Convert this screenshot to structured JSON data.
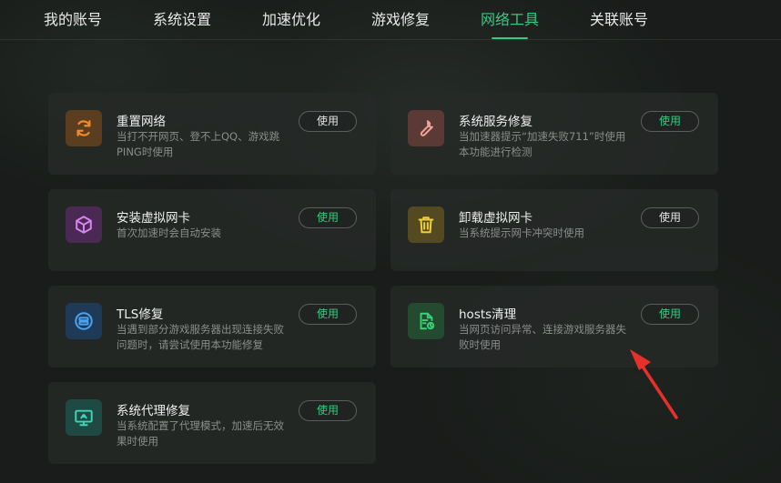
{
  "nav": {
    "tabs": [
      {
        "label": "我的账号"
      },
      {
        "label": "系统设置"
      },
      {
        "label": "加速优化"
      },
      {
        "label": "游戏修复"
      },
      {
        "label": "网络工具"
      },
      {
        "label": "关联账号"
      }
    ],
    "active_tab": "网络工具"
  },
  "tools": [
    {
      "title": "重置网络",
      "desc": "当打不开网页、登不上QQ、游戏跳PING时使用",
      "button": "使用",
      "icon": "refresh-icon",
      "tile_color": "#5a3e1f",
      "icon_color": "#f08a2a"
    },
    {
      "title": "系统服务修复",
      "desc": "当加速器提示“加速失败711”时使用本功能进行检测",
      "button": "使用",
      "icon": "wrench-icon",
      "tile_color": "#5b3a36",
      "icon_color": "#f0a39a"
    },
    {
      "title": "安装虚拟网卡",
      "desc": "首次加速时会自动安装",
      "button": "使用",
      "icon": "cube-icon",
      "tile_color": "#4a2a55",
      "icon_color": "#d784f0"
    },
    {
      "title": "卸载虚拟网卡",
      "desc": "当系统提示网卡冲突时使用",
      "button": "使用",
      "icon": "trash-icon",
      "tile_color": "#544a22",
      "icon_color": "#f0cf33"
    },
    {
      "title": "TLS修复",
      "desc": "当遇到部分游戏服务器出现连接失败问题时，请尝试使用本功能修复",
      "button": "使用",
      "icon": "server-icon",
      "tile_color": "#1e3a56",
      "icon_color": "#4aa3f0"
    },
    {
      "title": "hosts清理",
      "desc": "当网页访问异常、连接游戏服务器失败时使用",
      "button": "使用",
      "icon": "file-clean-icon",
      "tile_color": "#244a30",
      "icon_color": "#3ad278"
    },
    {
      "title": "系统代理修复",
      "desc": "当系统配置了代理模式，加速后无效果时使用",
      "button": "使用",
      "icon": "monitor-icon",
      "tile_color": "#1f4a44",
      "icon_color": "#3ad8b8"
    }
  ],
  "colors": {
    "accent": "#37c982",
    "annotation_arrow": "#e8302a"
  }
}
